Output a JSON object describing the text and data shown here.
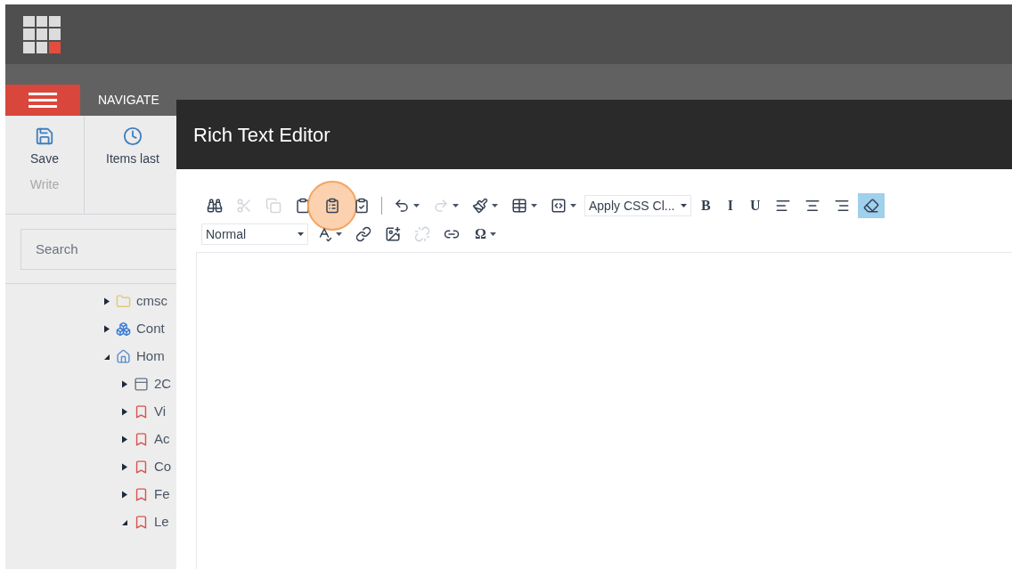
{
  "tabs": [
    {
      "label": "NAVIGATE",
      "selected": false
    }
  ],
  "ribbon": {
    "groups": [
      {
        "button": "Save",
        "caption": "Write"
      },
      {
        "button": "Items last"
      }
    ]
  },
  "search": {
    "placeholder": "Search"
  },
  "tree": [
    {
      "label": "cmsc",
      "expanded": false
    },
    {
      "label": "Cont",
      "expanded": false
    },
    {
      "label": "Hom",
      "expanded": true,
      "children": [
        {
          "label": "2C",
          "expanded": false
        },
        {
          "label": "Vi",
          "expanded": false
        },
        {
          "label": "Ac",
          "expanded": false
        },
        {
          "label": "Co",
          "expanded": false
        },
        {
          "label": "Fe",
          "expanded": false
        },
        {
          "label": "Le",
          "expanded": true
        }
      ]
    }
  ],
  "dialog": {
    "title": "Rich Text Editor",
    "toolbar_rows": [
      [
        {
          "kind": "button",
          "disabled": false
        },
        {
          "kind": "button",
          "disabled": true
        },
        {
          "kind": "button",
          "disabled": true
        },
        {
          "kind": "button",
          "disabled": false
        },
        {
          "kind": "button",
          "disabled": false,
          "highlighted": true
        },
        {
          "kind": "button",
          "disabled": false
        },
        {
          "kind": "separator"
        },
        {
          "kind": "button",
          "disabled": false,
          "dropdown": true
        },
        {
          "kind": "button",
          "disabled": true,
          "dropdown": true
        },
        {
          "kind": "button",
          "disabled": false,
          "dropdown": true
        },
        {
          "kind": "button",
          "disabled": false,
          "dropdown": true
        },
        {
          "kind": "button",
          "disabled": false,
          "dropdown": true
        },
        {
          "kind": "select",
          "value": "Apply CSS Cl..."
        },
        {
          "kind": "glyph",
          "label": "B",
          "selected": false
        },
        {
          "kind": "glyph",
          "label": "I",
          "selected": false
        },
        {
          "kind": "glyph",
          "label": "U",
          "selected": false
        },
        {
          "kind": "button",
          "disabled": false,
          "selected": false
        },
        {
          "kind": "button",
          "disabled": false,
          "selected": false
        },
        {
          "kind": "button",
          "disabled": false,
          "selected": false
        },
        {
          "kind": "button",
          "disabled": false,
          "selected": true
        }
      ],
      [
        {
          "kind": "select",
          "value": "Normal"
        },
        {
          "kind": "button",
          "disabled": false,
          "dropdown": true
        },
        {
          "kind": "button",
          "disabled": false
        },
        {
          "kind": "button",
          "disabled": false
        },
        {
          "kind": "button",
          "disabled": true
        },
        {
          "kind": "button",
          "disabled": false
        },
        {
          "kind": "glyph",
          "label": "Ω",
          "selected": false,
          "dropdown": true
        }
      ]
    ]
  }
}
